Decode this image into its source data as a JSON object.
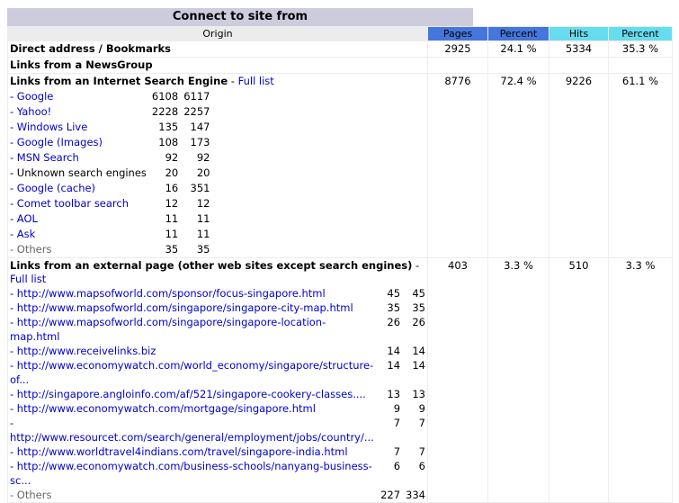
{
  "title": "Connect to site from",
  "headers": {
    "origin": "Origin",
    "pages": "Pages",
    "percent1": "Percent",
    "hits": "Hits",
    "percent2": "Percent"
  },
  "rows": {
    "direct": {
      "label": "Direct address / Bookmarks",
      "pages": "2925",
      "pct1": "24.1 %",
      "hits": "5334",
      "pct2": "35.3 %"
    },
    "newsgroup": {
      "label": "Links from a NewsGroup"
    },
    "search": {
      "label": "Links from an Internet Search Engine",
      "sep": " - ",
      "full_list": "Full list",
      "pages": "8776",
      "pct1": "72.4 %",
      "hits": "9226",
      "pct2": "61.1 %",
      "items": [
        {
          "name": "- Google",
          "a": "6108",
          "b": "6117"
        },
        {
          "name": "- Yahoo!",
          "a": "2228",
          "b": "2257"
        },
        {
          "name": "- Windows Live",
          "a": "135",
          "b": "147"
        },
        {
          "name": "- Google (Images)",
          "a": "108",
          "b": "173"
        },
        {
          "name": "- MSN Search",
          "a": "92",
          "b": "92"
        },
        {
          "name": "- Unknown search engines",
          "a": "20",
          "b": "20"
        },
        {
          "name": "- Google (cache)",
          "a": "16",
          "b": "351"
        },
        {
          "name": "- Comet toolbar search",
          "a": "12",
          "b": "12"
        },
        {
          "name": "- AOL",
          "a": "11",
          "b": "11"
        },
        {
          "name": "- Ask",
          "a": "11",
          "b": "11"
        },
        {
          "name": "- Others",
          "a": "35",
          "b": "35"
        }
      ]
    },
    "external": {
      "label": "Links from an external page (other web sites except search engines)",
      "sep": " -",
      "full_list": "Full list",
      "pages": "403",
      "pct1": "3.3 %",
      "hits": "510",
      "pct2": "3.3 %",
      "items": [
        {
          "name": "- http://www.mapsofworld.com/sponsor/focus-singapore.html",
          "a": "45",
          "b": "45"
        },
        {
          "name": "- http://www.mapsofworld.com/singapore/singapore-city-map.html",
          "a": "35",
          "b": "35"
        },
        {
          "name": "- http://www.mapsofworld.com/singapore/singapore-location-map.html",
          "a": "26",
          "b": "26"
        },
        {
          "name": "- http://www.receivelinks.biz",
          "a": "14",
          "b": "14"
        },
        {
          "name": "- http://www.economywatch.com/world_economy/singapore/structure-of...",
          "a": "14",
          "b": "14"
        },
        {
          "name": "- http://singapore.angloinfo.com/af/521/singapore-cookery-classes....",
          "a": "13",
          "b": "13"
        },
        {
          "name": "- http://www.economywatch.com/mortgage/singapore.html",
          "a": "9",
          "b": "9"
        },
        {
          "name": "- http://www.resourcet.com/search/general/employment/jobs/country/...",
          "a": "7",
          "b": "7"
        },
        {
          "name": "- http://www.worldtravel4indians.com/travel/singapore-india.html",
          "a": "7",
          "b": "7"
        },
        {
          "name": "- http://www.economywatch.com/business-schools/nanyang-business-sc...",
          "a": "6",
          "b": "6"
        },
        {
          "name": "- Others",
          "a": "227",
          "b": "334"
        }
      ]
    }
  }
}
